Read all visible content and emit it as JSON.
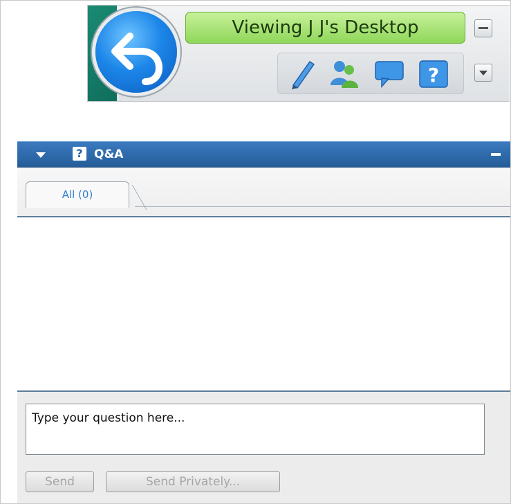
{
  "control_bar": {
    "status_text": "Viewing J J's Desktop",
    "icons": [
      "back-arrow-icon",
      "pen-icon",
      "participants-icon",
      "chat-icon",
      "help-icon"
    ],
    "colors": {
      "status_green": "#8fd75a",
      "accent_teal": "#0f6e5c",
      "back_blue": "#1c86e8"
    }
  },
  "qa_panel": {
    "title": "Q&A",
    "header_icon": "?",
    "tabs": [
      {
        "label": "All (0)"
      }
    ],
    "question_input": {
      "value": "Type your question here...",
      "placeholder": "Type your question here..."
    },
    "send_label": "Send",
    "send_privately_label": "Send Privately...",
    "colors": {
      "header_blue": "#2e6aaa",
      "tab_text": "#2f7fcf"
    }
  }
}
